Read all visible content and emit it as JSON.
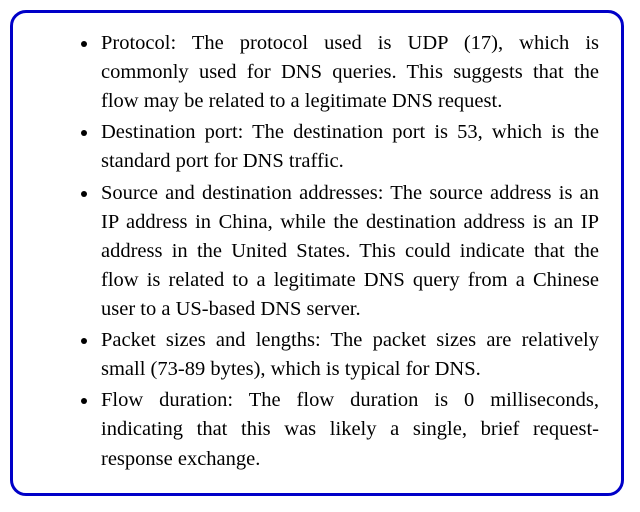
{
  "items": [
    "Protocol: The protocol used is UDP (17), which is commonly used for DNS queries. This suggests that the flow may be related to a legitimate DNS request.",
    "Destination port: The destination port is 53, which is the standard port for DNS traffic.",
    "Source and destination addresses: The source address is an IP address in China, while the destination address is an IP address in the United States. This could indicate that the flow is related to a legitimate DNS query from a Chinese user to a US-based DNS server.",
    "Packet sizes and lengths: The packet sizes are relatively small (73-89 bytes), which is typical for DNS.",
    "Flow duration: The flow duration is 0 milliseconds, indicating that this was likely a single, brief request-response exchange."
  ]
}
